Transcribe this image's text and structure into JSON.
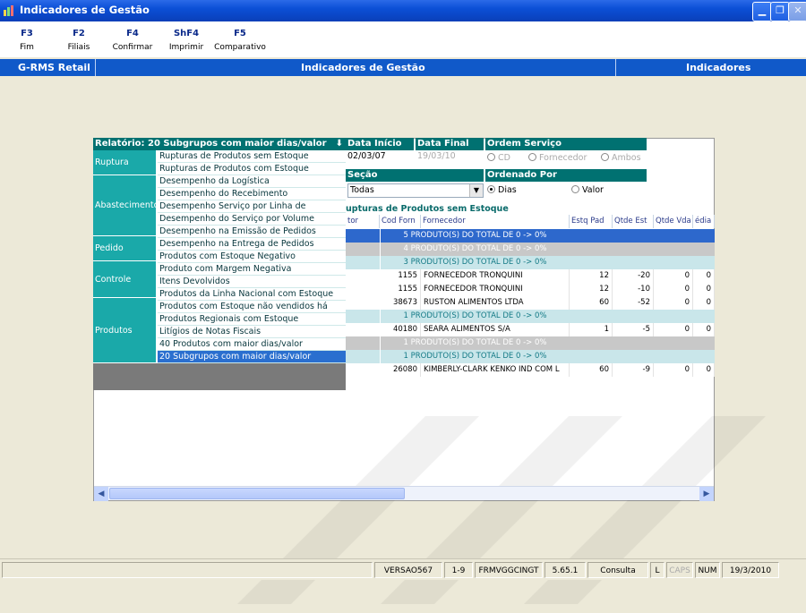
{
  "window": {
    "title": "Indicadores de Gestão"
  },
  "toolbar": {
    "keys": [
      {
        "key": "F3",
        "label": "Fim"
      },
      {
        "key": "F2",
        "label": "Filiais"
      },
      {
        "key": "F4",
        "label": "Confirmar"
      },
      {
        "key": "ShF4",
        "label": "Imprimir"
      },
      {
        "key": "F5",
        "label": "Comparativo"
      }
    ]
  },
  "header": {
    "left": "G-RMS Retail",
    "center": "Indicadores de Gestão",
    "right": "Indicadores"
  },
  "menu": {
    "title": "Relatório: 20 Subgrupos com maior dias/valor",
    "categories": [
      "Ruptura",
      "Abastecimento",
      "Pedido",
      "Controle",
      "Produtos"
    ],
    "items": [
      "Rupturas de Produtos sem Estoque",
      "Rupturas de Produtos com Estoque",
      "Desempenho da Logística",
      "Desempenho do Recebimento",
      "Desempenho Serviço por Linha de",
      "Desempenho do Serviço por Volume",
      "Desempenho na Emissão de Pedidos",
      "Desempenho na Entrega de Pedidos",
      "Produtos com Estoque Negativo",
      "Produto com Margem Negativa",
      "Itens Devolvidos",
      "Produtos da Linha Nacional com Estoque",
      "Produtos com Estoque não vendidos há",
      "Produtos Regionais com Estoque",
      "Litígios de Notas Fiscais",
      "40 Produtos com maior dias/valor",
      "20 Subgrupos com maior dias/valor"
    ]
  },
  "filters": {
    "data_inicio_label": "Data Início",
    "data_inicio": "02/03/07",
    "data_final_label": "Data Final",
    "data_final": "19/03/10",
    "ordem_servico_label": "Ordem Serviço",
    "ordem_options": [
      "CD",
      "Fornecedor",
      "Ambos"
    ],
    "secao_label": "Seção",
    "secao_value": "Todas",
    "ordenado_label": "Ordenado Por",
    "ordenado_options": [
      "Dias",
      "Valor"
    ]
  },
  "grid": {
    "title": "upturas de Produtos sem Estoque",
    "columns": [
      "tor",
      "Cod Forn",
      "Fornecedor",
      "Estq Pad",
      "Qtde Est",
      "Qtde Vda",
      "édia"
    ],
    "rows": [
      {
        "type": "sum",
        "text": "5 PRODUTO(S) DO TOTAL DE 0 -> 0%"
      },
      {
        "type": "sum",
        "text": "4 PRODUTO(S) DO TOTAL DE 0 -> 0%"
      },
      {
        "type": "sum",
        "text": "3 PRODUTO(S) DO TOTAL DE 0 -> 0%"
      },
      {
        "type": "data",
        "cod": "1155",
        "forn": "FORNECEDOR TRONQUINI",
        "estq": "12",
        "qest": "-20",
        "qvda": "0",
        "med": "0"
      },
      {
        "type": "data",
        "cod": "1155",
        "forn": "FORNECEDOR TRONQUINI",
        "estq": "12",
        "qest": "-10",
        "qvda": "0",
        "med": "0"
      },
      {
        "type": "data",
        "cod": "38673",
        "forn": "RUSTON ALIMENTOS LTDA",
        "estq": "60",
        "qest": "-52",
        "qvda": "0",
        "med": "0"
      },
      {
        "type": "sum",
        "text": "1 PRODUTO(S) DO TOTAL DE 0 -> 0%"
      },
      {
        "type": "data",
        "cod": "40180",
        "forn": "SEARA ALIMENTOS S/A",
        "estq": "1",
        "qest": "-5",
        "qvda": "0",
        "med": "0"
      },
      {
        "type": "sum",
        "text": "1 PRODUTO(S) DO TOTAL DE 0 -> 0%"
      },
      {
        "type": "sum",
        "text": "1 PRODUTO(S) DO TOTAL DE 0 -> 0%"
      },
      {
        "type": "data",
        "cod": "26080",
        "forn": "KIMBERLY-CLARK KENKO IND COM L",
        "estq": "60",
        "qest": "-9",
        "qvda": "0",
        "med": "0"
      }
    ]
  },
  "status": {
    "version": "VERSAO567",
    "page": "1-9",
    "form": "FRMVGGCINGT",
    "build": "5.65.1",
    "mode": "Consulta",
    "l": "L",
    "caps": "CAPS",
    "num": "NUM",
    "date": "19/3/2010"
  },
  "colors": {
    "accent": "#007171",
    "selection": "#2a6fcf",
    "header": "#1059c9"
  }
}
